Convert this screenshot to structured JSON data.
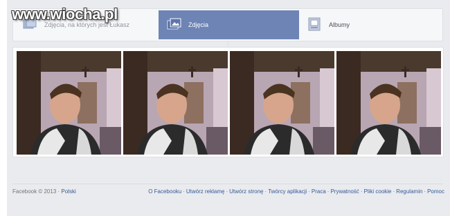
{
  "watermark": "www.wiocha.pl",
  "tabs": [
    {
      "label": "Zdjęcia, na których jest Łukasz",
      "icon": "tagged-photos-icon",
      "active": false
    },
    {
      "label": "Zdjęcia",
      "icon": "photos-icon",
      "active": true
    },
    {
      "label": "Albumy",
      "icon": "albums-icon",
      "active": false
    }
  ],
  "photos_count_shown": 4,
  "footer": {
    "copyright": "Facebook © 2013 ·",
    "language": "Polski",
    "links": [
      "O Facebooku",
      "Utwórz reklamę",
      "Utwórz stronę",
      "Twórcy aplikacji",
      "Praca",
      "Prywatność",
      "Pliki cookie",
      "Regulamin",
      "Pomoc"
    ]
  },
  "colors": {
    "active_tab": "#6d84b4",
    "link": "#365899",
    "page_background": "#e9ebee"
  }
}
